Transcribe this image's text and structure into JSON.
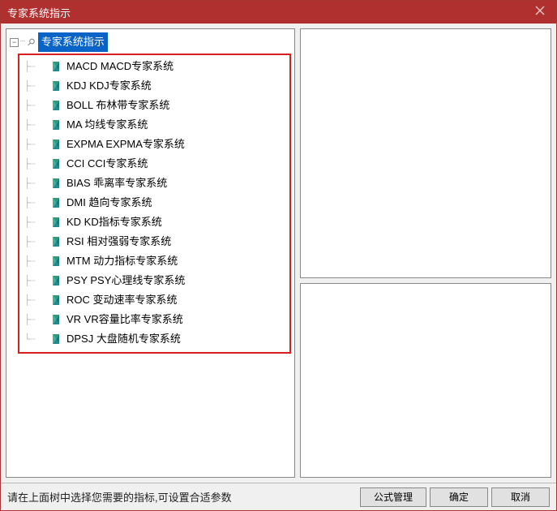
{
  "titlebar": {
    "title": "专家系统指示"
  },
  "tree": {
    "root_label": "专家系统指示",
    "items": [
      {
        "label": "MACD MACD专家系统"
      },
      {
        "label": "KDJ KDJ专家系统"
      },
      {
        "label": "BOLL 布林带专家系统"
      },
      {
        "label": "MA 均线专家系统"
      },
      {
        "label": "EXPMA EXPMA专家系统"
      },
      {
        "label": "CCI CCI专家系统"
      },
      {
        "label": "BIAS 乖离率专家系统"
      },
      {
        "label": "DMI 趋向专家系统"
      },
      {
        "label": "KD KD指标专家系统"
      },
      {
        "label": "RSI 相对强弱专家系统"
      },
      {
        "label": "MTM 动力指标专家系统"
      },
      {
        "label": "PSY PSY心理线专家系统"
      },
      {
        "label": "ROC 变动速率专家系统"
      },
      {
        "label": "VR VR容量比率专家系统"
      },
      {
        "label": "DPSJ 大盘随机专家系统"
      }
    ]
  },
  "footer": {
    "hint": "请在上面树中选择您需要的指标,可设置合适参数",
    "formula_button": "公式管理",
    "ok_button": "确定",
    "cancel_button": "取消"
  }
}
